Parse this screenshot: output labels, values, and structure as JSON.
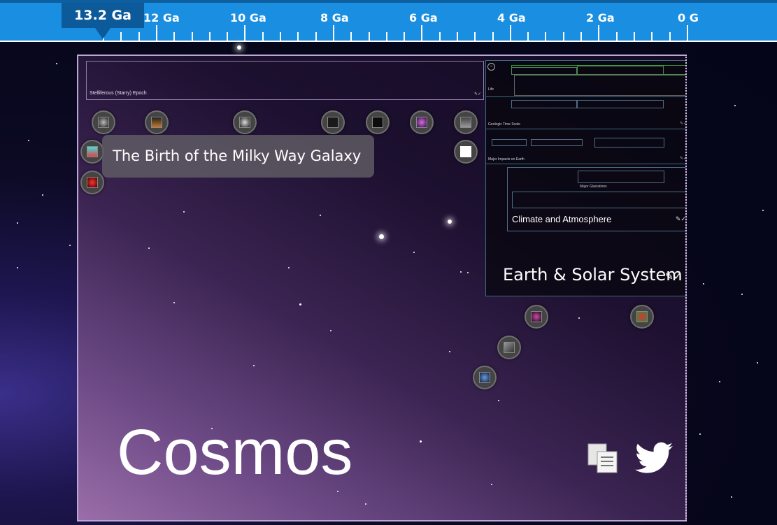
{
  "timeline": {
    "current": "13.2 Ga",
    "labels": [
      "12 Ga",
      "10 Ga",
      "8 Ga",
      "6 Ga",
      "4 Ga",
      "2 Ga",
      "0 G"
    ]
  },
  "cosmos": {
    "title": "Cosmos",
    "epoch_label": "Stelliferous (Starry) Epoch",
    "tooltip": "The Birth of the Milky Way Galaxy"
  },
  "earth": {
    "title": "Earth & Solar System",
    "life_label": "Life",
    "geologic_label": "Geologic Time Scale",
    "impacts_label": "Major Impacts on Earth",
    "ice_label": "Major Glaciations",
    "climate_label": "Climate and Atmosphere"
  },
  "icons": [
    "copy-icon",
    "twitter-icon",
    "zoom-icon"
  ],
  "colors": {
    "ruler": "#1a8ee0",
    "marker": "#0c5a9a",
    "frame": "#b9a7d4"
  }
}
